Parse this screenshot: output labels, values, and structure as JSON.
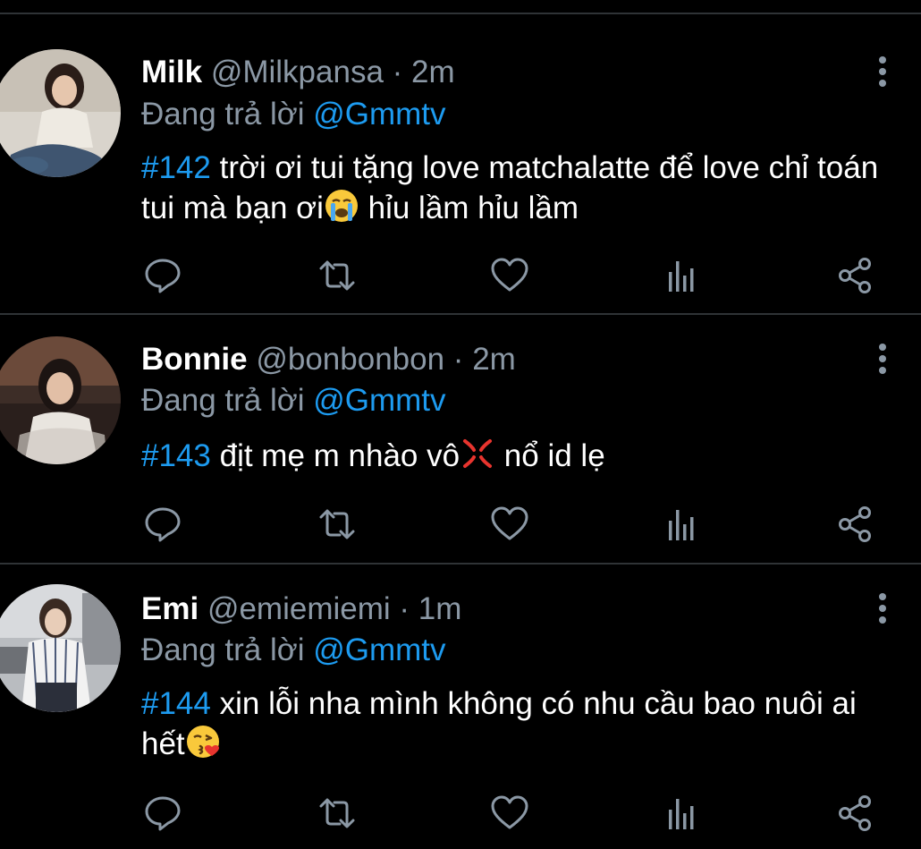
{
  "tweets": [
    {
      "name": "Milk",
      "handle": "@Milkpansa",
      "separator": "·",
      "time": "2m",
      "reply_prefix": "Đang trả lời",
      "reply_to": "@Gmmtv",
      "hashtag": "#142",
      "text_1": " trời ơi tui tặng love matchalatte để love chỉ toán tui mà bạn ơi",
      "emoji": "crying-face-emoji",
      "text_2": " hỉu lầm hỉu lầm"
    },
    {
      "name": "Bonnie",
      "handle": "@bonbonbon",
      "separator": "·",
      "time": "2m",
      "reply_prefix": "Đang trả lời",
      "reply_to": "@Gmmtv",
      "hashtag": "#143",
      "text_1": " địt mẹ m nhào vô",
      "emoji": "anger-symbol-emoji",
      "text_2": " nổ id lẹ"
    },
    {
      "name": "Emi",
      "handle": "@emiemiemi",
      "separator": "·",
      "time": "1m",
      "reply_prefix": "Đang trả lời",
      "reply_to": "@Gmmtv",
      "hashtag": "#144",
      "text_1": " xin lỗi nha mình không có nhu cầu bao nuôi ai hết",
      "emoji": "face-blowing-kiss-emoji",
      "text_2": ""
    }
  ],
  "icons": {
    "more": "more-vertical-icon",
    "reply": "reply-icon",
    "retweet": "retweet-icon",
    "like": "like-icon",
    "views": "views-icon",
    "share": "share-icon"
  },
  "colors": {
    "background": "#000000",
    "text": "#ffffff",
    "secondary": "#8b98a5",
    "accent": "#1d9bf0",
    "divider": "#2f3336"
  }
}
